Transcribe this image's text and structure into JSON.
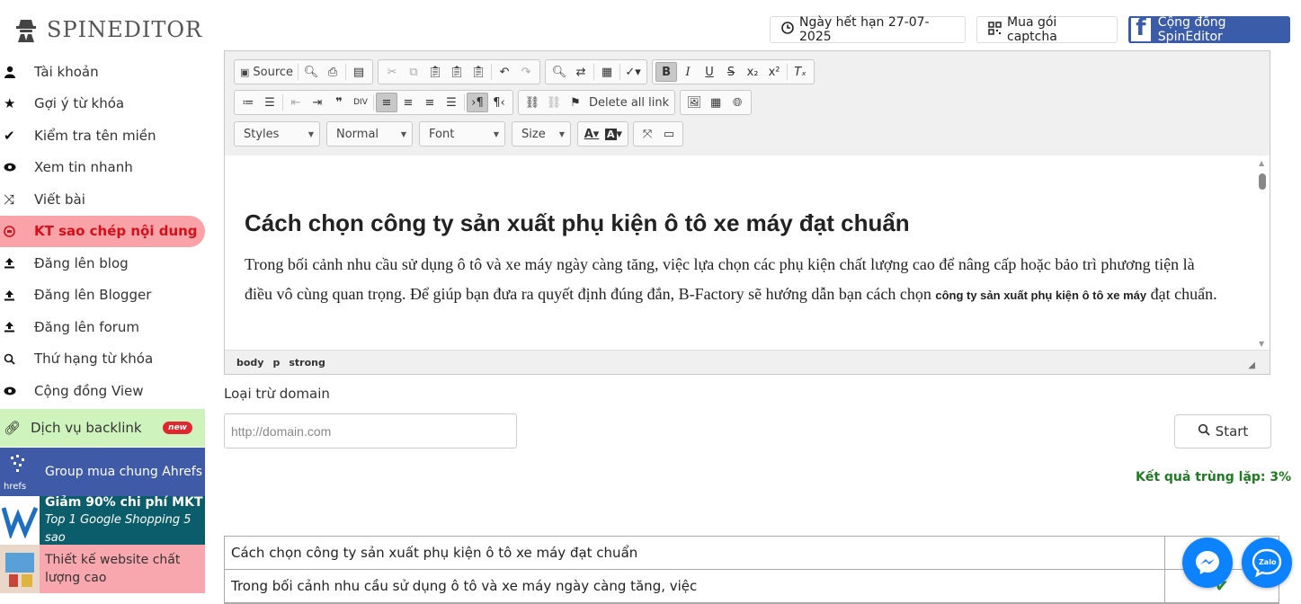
{
  "header": {
    "logo_text": "SPINEDITOR",
    "expiry": "Ngày hết hạn 27-07-2025",
    "buy_captcha": "Mua gói captcha",
    "community_fb": "Cộng đồng SpinEditor"
  },
  "sidebar": {
    "items": [
      {
        "label": "Tài khoản",
        "icon": "user-icon"
      },
      {
        "label": "Gợi ý từ khóa",
        "icon": "star-icon"
      },
      {
        "label": "Kiểm tra tên miền",
        "icon": "check-icon"
      },
      {
        "label": "Xem tin nhanh",
        "icon": "eye-icon"
      },
      {
        "label": "Viết bài",
        "icon": "shuffle-icon"
      },
      {
        "label": "KT sao chép nội dung",
        "icon": "copy-check-icon",
        "active": true
      },
      {
        "label": "Đăng lên blog",
        "icon": "upload-icon"
      },
      {
        "label": "Đăng lên Blogger",
        "icon": "upload-icon"
      },
      {
        "label": "Đăng lên forum",
        "icon": "upload-icon"
      },
      {
        "label": "Thứ hạng từ khóa",
        "icon": "search-icon"
      },
      {
        "label": "Cộng đồng View",
        "icon": "eye-icon"
      }
    ],
    "backlink": {
      "label": "Dịch vụ backlink",
      "badge": "new"
    },
    "promos": [
      {
        "label": "Group mua chung Ahrefs",
        "img_text": "ahrefs"
      },
      {
        "title": "Giảm 90% chi phí MKT",
        "subtitle": "Top 1 Google Shopping 5 sao"
      },
      {
        "label": "Thiết kế website chất lượng cao"
      }
    ]
  },
  "editor": {
    "toolbar1": {
      "source": "Source"
    },
    "toolbar2": {
      "delete_all_link": "Delete all link"
    },
    "toolbar3": {
      "styles": "Styles",
      "format": "Normal",
      "font": "Font",
      "size": "Size"
    },
    "heading": "Cách chọn công ty sản xuất phụ kiện ô tô xe máy đạt chuẩn",
    "paragraph_pre": "Trong bối cảnh nhu cầu sử dụng ô tô và xe máy ngày càng tăng, việc lựa chọn các phụ kiện chất lượng cao để nâng cấp hoặc bảo trì phương tiện là điều vô cùng quan trọng. Để giúp bạn đưa ra quyết định đúng đắn, B-Factory sẽ hướng dẫn bạn cách chọn ",
    "paragraph_strong": "công ty sản xuất phụ kiện ô tô xe máy",
    "paragraph_post": " đạt chuẩn.",
    "path": [
      "body",
      "p",
      "strong"
    ]
  },
  "exclude": {
    "label": "Loại trừ domain",
    "placeholder": "http://domain.com"
  },
  "start_label": "Start",
  "result_text": "Kết quả trùng lặp: 3%",
  "results": [
    {
      "text": "Cách chọn công ty sản xuất phụ kiện ô tô xe máy đạt chuẩn"
    },
    {
      "text": "Trong bối cảnh nhu cầu sử dụng ô tô và xe máy ngày càng tăng, việc"
    }
  ],
  "colors": {
    "active_bg": "#f9a3a8",
    "active_text": "#d4101a",
    "result_green": "#1d7c21",
    "ahrefs_blue": "#3f5aa6",
    "mkt_teal": "#0c5d6c",
    "fb_blue": "#3b5ca8"
  }
}
